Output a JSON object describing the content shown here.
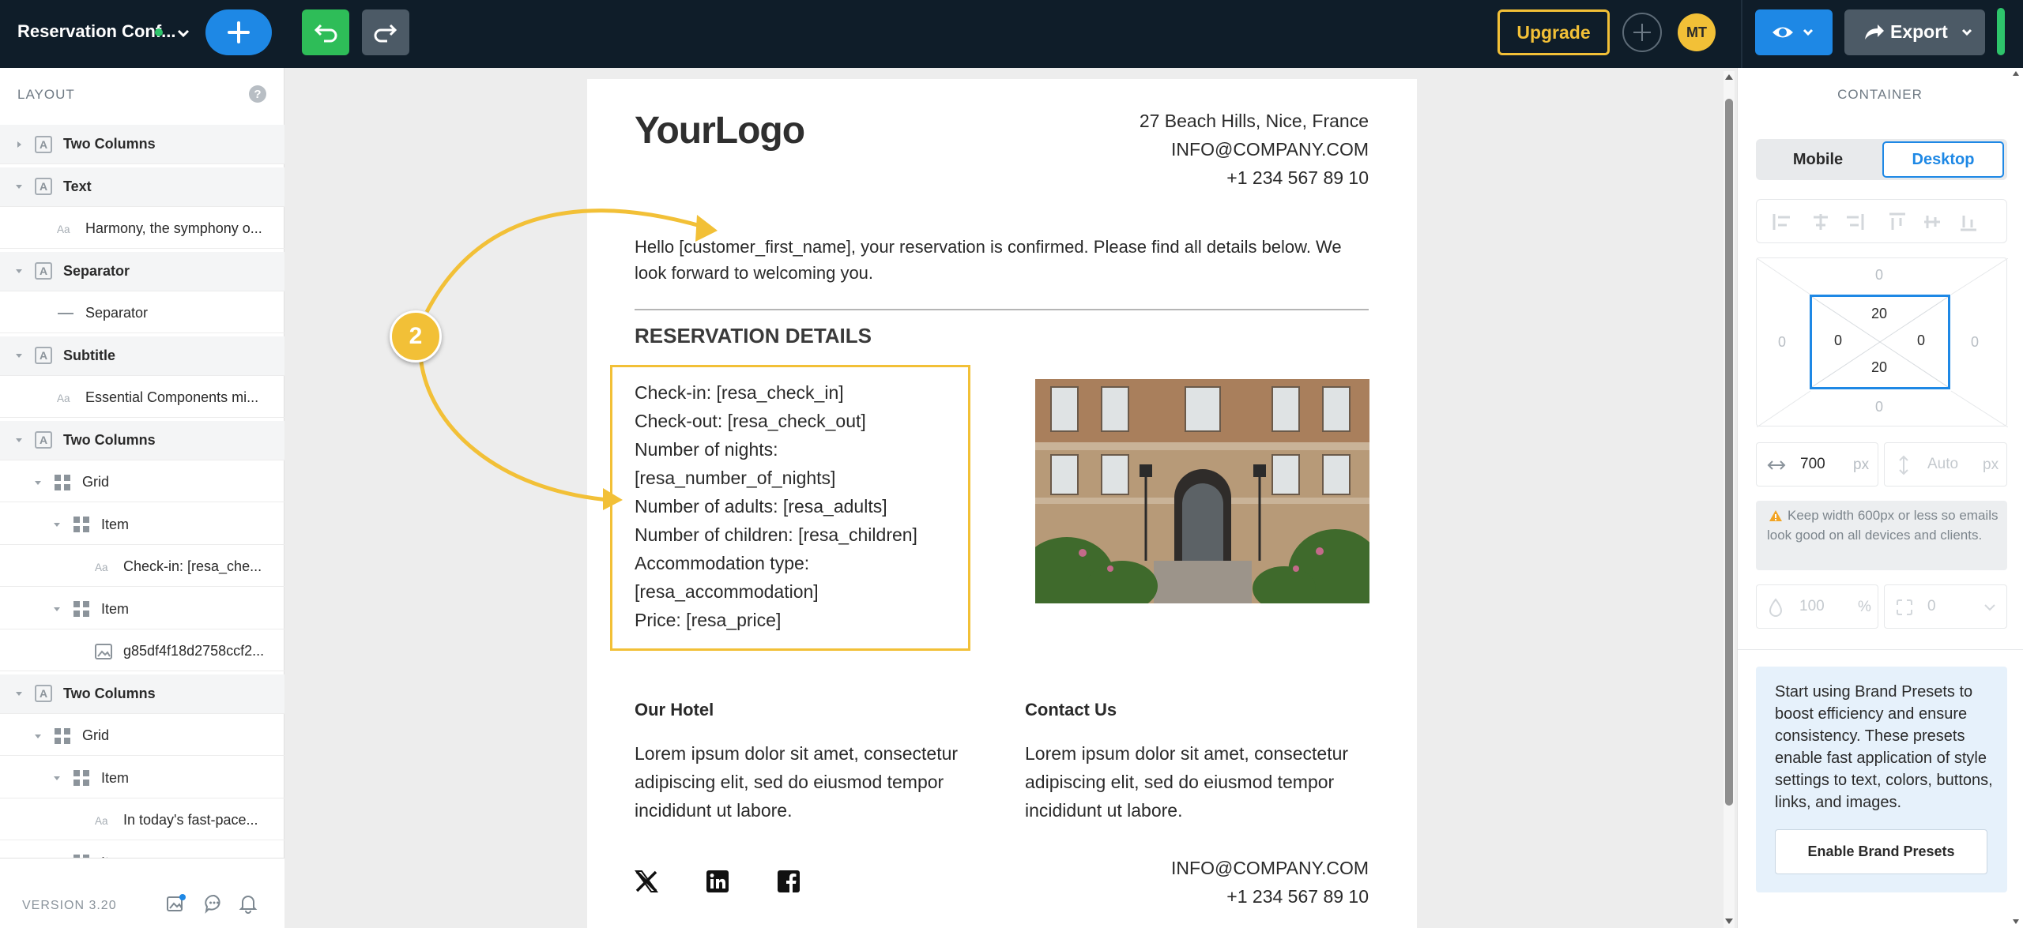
{
  "topbar": {
    "doc_title": "Reservation Conf...",
    "upgrade_label": "Upgrade",
    "avatar_initials": "MT",
    "export_label": "Export",
    "accent_color": "#1e88e5",
    "icons": [
      "add-icon",
      "undo-icon",
      "redo-icon",
      "plus-circle-icon",
      "eye-icon",
      "share-icon",
      "chevron-down-icon"
    ]
  },
  "left": {
    "header": "LAYOUT",
    "help": "?",
    "version": "VERSION 3.20",
    "rows": [
      {
        "label": "Two Columns",
        "kind": "section"
      },
      {
        "label": "Text",
        "kind": "section"
      },
      {
        "label": "Harmony, the symphony o...",
        "kind": "text"
      },
      {
        "label": "Separator",
        "kind": "section"
      },
      {
        "label": "Separator",
        "kind": "separator"
      },
      {
        "label": "Subtitle",
        "kind": "section"
      },
      {
        "label": "Essential Components mi...",
        "kind": "text"
      },
      {
        "label": "Two Columns",
        "kind": "section"
      },
      {
        "label": "Grid",
        "kind": "grid"
      },
      {
        "label": "Item",
        "kind": "grid"
      },
      {
        "label": "Check-in: [resa_che...",
        "kind": "text"
      },
      {
        "label": "Item",
        "kind": "grid"
      },
      {
        "label": "g85df4f18d2758ccf2...",
        "kind": "image"
      },
      {
        "label": "Two Columns",
        "kind": "section"
      },
      {
        "label": "Grid",
        "kind": "grid"
      },
      {
        "label": "Item",
        "kind": "grid"
      },
      {
        "label": "In today's fast-pace...",
        "kind": "text"
      },
      {
        "label": "Item",
        "kind": "grid"
      }
    ]
  },
  "email": {
    "logo": "YourLogo",
    "address": "27 Beach Hills, Nice, France",
    "email": "INFO@COMPANY.COM",
    "phone": "+1 234 567 89 10",
    "greeting": "Hello [customer_first_name], your reservation is confirmed. Please find all details below. We look forward to welcoming you.",
    "section_title": "RESERVATION DETAILS",
    "details": [
      "Check-in: [resa_check_in]",
      "Check-out: [resa_check_out]",
      "Number of nights:",
      "[resa_number_of_nights]",
      "Number of adults: [resa_adults]",
      "Number of children: [resa_children]",
      "Accommodation type:",
      "[resa_accommodation]",
      "Price: [resa_price]"
    ],
    "col1_title": "Our Hotel",
    "col1_text": "Lorem ipsum dolor sit amet, consectetur adipiscing elit, sed do eiusmod tempor incididunt ut labore.",
    "col2_title": "Contact Us",
    "col2_text": "Lorem ipsum dolor sit amet, consectetur adipiscing elit, sed do eiusmod tempor incididunt ut labore.",
    "footer_email": "INFO@COMPANY.COM",
    "footer_phone": "+1 234 567 89 10",
    "social_icons": [
      "x-icon",
      "linkedin-icon",
      "facebook-icon"
    ]
  },
  "annotation": {
    "step": "2",
    "color": "#f2c037"
  },
  "right": {
    "title": "CONTAINER",
    "mobile_label": "Mobile",
    "desktop_label": "Desktop",
    "margin_top": "0",
    "margin_right": "0",
    "margin_bottom": "0",
    "margin_left": "0",
    "padding_top": "20",
    "padding_right": "0",
    "padding_bottom": "20",
    "padding_left": "0",
    "width_value": "700",
    "width_unit": "px",
    "height_placeholder": "Auto",
    "height_unit": "px",
    "warning": "Keep width 600px or less so emails look good on all devices and clients.",
    "opacity_value": "100",
    "opacity_unit": "%",
    "radius_value": "0",
    "presets_text": "Start using Brand Presets to boost efficiency and ensure consistency. These presets enable fast application of style settings to text, colors, buttons, links, and images.",
    "presets_button": "Enable Brand Presets"
  }
}
